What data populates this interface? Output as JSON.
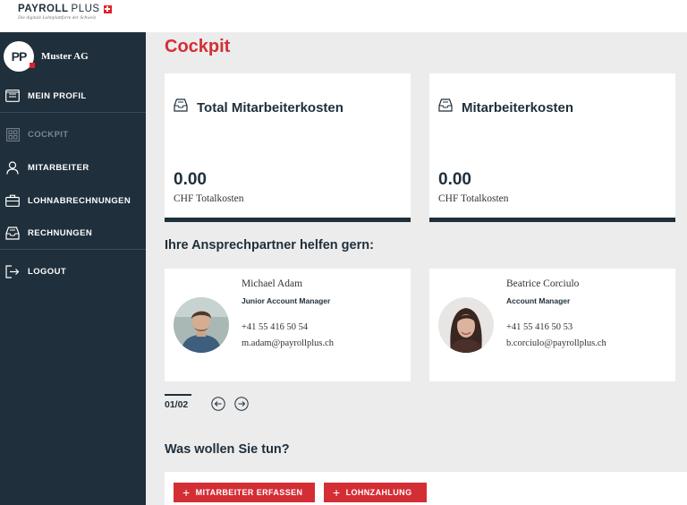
{
  "brand": {
    "name": "PAYROLL",
    "name_suffix": "PLUS",
    "tagline": "Die digitale Lohnplattform der Schweiz"
  },
  "sidebar": {
    "company_initials": "PP",
    "company_name": "Muster AG",
    "items": [
      {
        "label": "MEIN PROFIL",
        "icon": "profile-card-icon"
      },
      {
        "label": "COCKPIT",
        "icon": "dashboard-icon",
        "active": true
      },
      {
        "label": "MITARBEITER",
        "icon": "user-icon"
      },
      {
        "label": "LOHNABRECHNUNGEN",
        "icon": "briefcase-icon"
      },
      {
        "label": "RECHNUNGEN",
        "icon": "invoice-icon"
      },
      {
        "label": "LOGOUT",
        "icon": "logout-icon"
      }
    ]
  },
  "main": {
    "title": "Cockpit",
    "stats": [
      {
        "title": "Total Mitarbeiterkosten",
        "value": "0.00",
        "unit": "CHF Totalkosten",
        "icon": "inbox-icon"
      },
      {
        "title": "Mitarbeiterkosten",
        "value": "0.00",
        "unit": "CHF Totalkosten",
        "icon": "inbox-icon"
      }
    ],
    "contacts_title": "Ihre Ansprechpartner helfen gern:",
    "contacts": [
      {
        "name": "Michael Adam",
        "role": "Junior Account Manager",
        "phone": "+41 55 416 50 54",
        "email": "m.adam@payrollplus.ch"
      },
      {
        "name": "Beatrice Corciulo",
        "role": "Account Manager",
        "phone": "+41 55 416 50 53",
        "email": "b.corciulo@payrollplus.ch"
      }
    ],
    "pager": "01/02",
    "actions_title": "Was wollen Sie tun?",
    "actions": [
      {
        "label": "MITARBEITER ERFASSEN"
      },
      {
        "label": "LOHNZAHLUNG"
      }
    ]
  },
  "colors": {
    "accent": "#d42e35",
    "sidebar": "#1f2f3b",
    "background": "#ececec"
  }
}
